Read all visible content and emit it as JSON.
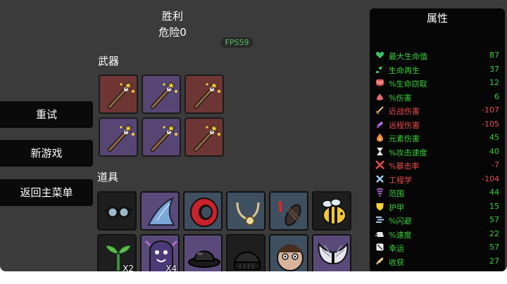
{
  "header": {
    "result": "胜利",
    "danger": "危险0",
    "fps": "FPS59"
  },
  "menu": {
    "retry": "重试",
    "new_game": "新游戏",
    "main_menu": "返回主菜单"
  },
  "weapons": {
    "label": "武器",
    "slots": [
      {
        "icon": "magic-wand-icon",
        "tier": "red"
      },
      {
        "icon": "magic-wand-icon",
        "tier": "purple"
      },
      {
        "icon": "magic-wand-icon",
        "tier": "red"
      },
      {
        "icon": "magic-wand-icon",
        "tier": "purple"
      },
      {
        "icon": "magic-wand-icon",
        "tier": "purple"
      },
      {
        "icon": "magic-wand-icon",
        "tier": "red"
      }
    ]
  },
  "items": {
    "label": "道具",
    "slots": [
      {
        "icon": "glasses-icon",
        "tier": "black",
        "qty": ""
      },
      {
        "icon": "shark-fin-icon",
        "tier": "purple",
        "qty": ""
      },
      {
        "icon": "red-ring-icon",
        "tier": "blue",
        "qty": ""
      },
      {
        "icon": "pendant-icon",
        "tier": "blue",
        "qty": ""
      },
      {
        "icon": "leech-icon",
        "tier": "blue",
        "qty": ""
      },
      {
        "icon": "bee-icon",
        "tier": "black",
        "qty": ""
      },
      {
        "icon": "sprout-icon",
        "tier": "black",
        "qty": "X2"
      },
      {
        "icon": "ghost-icon",
        "tier": "purple",
        "qty": "X4"
      },
      {
        "icon": "bowler-hat-icon",
        "tier": "purple",
        "qty": ""
      },
      {
        "icon": "beanie-icon",
        "tier": "black",
        "qty": ""
      },
      {
        "icon": "face-icon",
        "tier": "blue",
        "qty": ""
      },
      {
        "icon": "wings-icon",
        "tier": "purple",
        "qty": ""
      }
    ]
  },
  "stats": {
    "title": "属性",
    "rows": [
      {
        "icon": "heart-icon",
        "label": "最大生命值",
        "value": "87",
        "color": "#36d136"
      },
      {
        "icon": "regen-icon",
        "label": "生命再生",
        "value": "37",
        "color": "#36d136"
      },
      {
        "icon": "lifesteal-icon",
        "label": "%生命窃取",
        "value": "12",
        "color": "#36d136"
      },
      {
        "icon": "damage-icon",
        "label": "%伤害",
        "value": "6",
        "color": "#36d136"
      },
      {
        "icon": "melee-icon",
        "label": "近战伤害",
        "value": "-107",
        "color": "#e84b4b"
      },
      {
        "icon": "ranged-icon",
        "label": "远程伤害",
        "value": "-105",
        "color": "#e84b4b"
      },
      {
        "icon": "elemental-icon",
        "label": "元素伤害",
        "value": "45",
        "color": "#36d136"
      },
      {
        "icon": "attack-speed-icon",
        "label": "%攻击速度",
        "value": "40",
        "color": "#36d136"
      },
      {
        "icon": "crit-icon",
        "label": "%暴击率",
        "value": "-7",
        "color": "#e84b4b"
      },
      {
        "icon": "engineering-icon",
        "label": "工程学",
        "value": "-104",
        "color": "#e84b4b"
      },
      {
        "icon": "range-icon",
        "label": "范围",
        "value": "44",
        "color": "#36d136"
      },
      {
        "icon": "armor-icon",
        "label": "护甲",
        "value": "15",
        "color": "#36d136"
      },
      {
        "icon": "dodge-icon",
        "label": "%闪避",
        "value": "57",
        "color": "#36d136"
      },
      {
        "icon": "speed-icon",
        "label": "%速度",
        "value": "22",
        "color": "#36d136"
      },
      {
        "icon": "luck-icon",
        "label": "幸运",
        "value": "57",
        "color": "#36d136"
      },
      {
        "icon": "harvest-icon",
        "label": "收获",
        "value": "27",
        "color": "#36d136"
      }
    ]
  }
}
